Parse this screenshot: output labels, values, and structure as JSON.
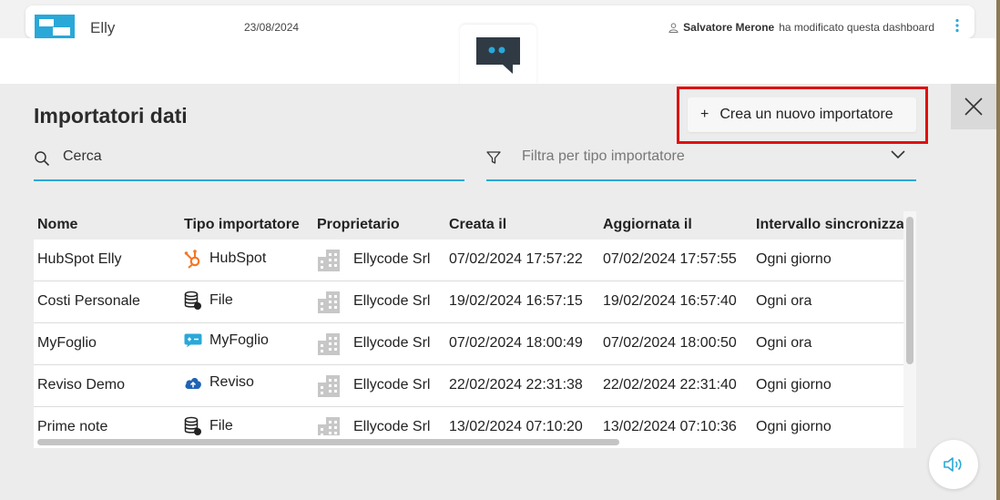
{
  "topbar": {
    "app_name": "Elly",
    "date": "23/08/2024",
    "modified_by": "Salvatore Merone",
    "modified_text": "ha modificato questa dashboard"
  },
  "modal": {
    "title": "Importatori dati",
    "create_button": "Crea un nuovo importatore",
    "create_icon": "+",
    "search_value": "Cerca",
    "filter_placeholder": "Filtra per tipo importatore"
  },
  "table": {
    "headers": [
      "Nome",
      "Tipo importatore",
      "Proprietario",
      "Creata il",
      "Aggiornata il",
      "Intervallo sincronizza"
    ],
    "rows": [
      {
        "name": "HubSpot Elly",
        "type": "HubSpot",
        "type_icon": "hubspot-icon",
        "owner": "Ellycode Srl",
        "created": "07/02/2024 17:57:22",
        "updated": "07/02/2024 17:57:55",
        "interval": "Ogni giorno"
      },
      {
        "name": "Costi Personale",
        "type": "File",
        "type_icon": "database-file-icon",
        "owner": "Ellycode Srl",
        "created": "19/02/2024 16:57:15",
        "updated": "19/02/2024 16:57:40",
        "interval": "Ogni ora"
      },
      {
        "name": "MyFoglio",
        "type": "MyFoglio",
        "type_icon": "myfoglio-icon",
        "owner": "Ellycode Srl",
        "created": "07/02/2024 18:00:49",
        "updated": "07/02/2024 18:00:50",
        "interval": "Ogni ora"
      },
      {
        "name": "Reviso Demo",
        "type": "Reviso",
        "type_icon": "cloud-upload-icon",
        "owner": "Ellycode Srl",
        "created": "22/02/2024 22:31:38",
        "updated": "22/02/2024 22:31:40",
        "interval": "Ogni giorno"
      },
      {
        "name": "Prime note",
        "type": "File",
        "type_icon": "database-file-icon",
        "owner": "Ellycode Srl",
        "created": "13/02/2024 07:10:20",
        "updated": "13/02/2024 07:10:36",
        "interval": "Ogni giorno"
      }
    ]
  },
  "colors": {
    "accent": "#2aa8d8",
    "highlight": "#e01010",
    "hubspot": "#f57722",
    "reviso": "#1f63b5"
  }
}
